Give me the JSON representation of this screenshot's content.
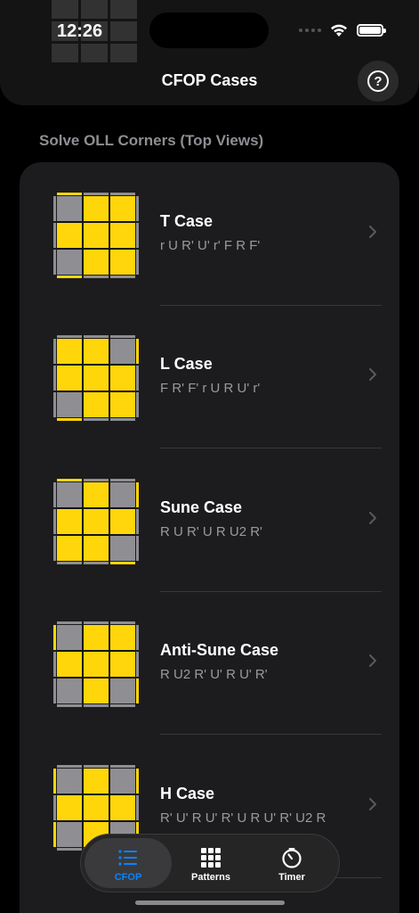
{
  "status_bar": {
    "time": "12:26"
  },
  "nav": {
    "title": "CFOP Cases",
    "help_glyph": "?"
  },
  "section": {
    "header": "Solve OLL Corners (Top Views)"
  },
  "colors": {
    "yellow": "#ffd60a",
    "gray": "#8e8e93",
    "accent": "#0a84ff"
  },
  "cases": [
    {
      "title": "T Case",
      "algorithm": "r U R' U' r' F R F'",
      "cube": {
        "grid": [
          "GYY",
          "YYY",
          "GYY"
        ],
        "top": [
          "Y",
          "G",
          "G"
        ],
        "bottom": [
          "Y",
          "G",
          "G"
        ],
        "left": [
          "G",
          "G",
          "G"
        ],
        "right": [
          "G",
          "G",
          "G"
        ]
      }
    },
    {
      "title": "L Case",
      "algorithm": "F R' F' r U R U' r'",
      "cube": {
        "grid": [
          "YYG",
          "YYY",
          "GYY"
        ],
        "top": [
          "G",
          "G",
          "G"
        ],
        "bottom": [
          "Y",
          "G",
          "G"
        ],
        "left": [
          "G",
          "G",
          "G"
        ],
        "right": [
          "Y",
          "G",
          "G"
        ]
      }
    },
    {
      "title": "Sune Case",
      "algorithm": "R U R' U R U2 R'",
      "cube": {
        "grid": [
          "GYG",
          "YYY",
          "YYG"
        ],
        "top": [
          "Y",
          "G",
          "G"
        ],
        "bottom": [
          "G",
          "G",
          "Y"
        ],
        "left": [
          "G",
          "G",
          "G"
        ],
        "right": [
          "Y",
          "G",
          "G"
        ]
      }
    },
    {
      "title": "Anti-Sune Case",
      "algorithm": "R U2 R' U' R U' R'",
      "cube": {
        "grid": [
          "GYY",
          "YYY",
          "GYG"
        ],
        "top": [
          "G",
          "G",
          "G"
        ],
        "bottom": [
          "G",
          "G",
          "G"
        ],
        "left": [
          "Y",
          "G",
          "G"
        ],
        "right": [
          "G",
          "G",
          "Y"
        ]
      }
    },
    {
      "title": "H Case",
      "algorithm": "R' U' R U' R' U R U' R' U2 R",
      "cube": {
        "grid": [
          "GYG",
          "YYY",
          "GYG"
        ],
        "top": [
          "G",
          "G",
          "G"
        ],
        "bottom": [
          "G",
          "G",
          "G"
        ],
        "left": [
          "Y",
          "G",
          "Y"
        ],
        "right": [
          "Y",
          "G",
          "Y"
        ]
      }
    }
  ],
  "tabs": [
    {
      "label": "CFOP",
      "icon": "list-icon",
      "active": true
    },
    {
      "label": "Patterns",
      "icon": "grid-icon",
      "active": false
    },
    {
      "label": "Timer",
      "icon": "timer-icon",
      "active": false
    }
  ]
}
